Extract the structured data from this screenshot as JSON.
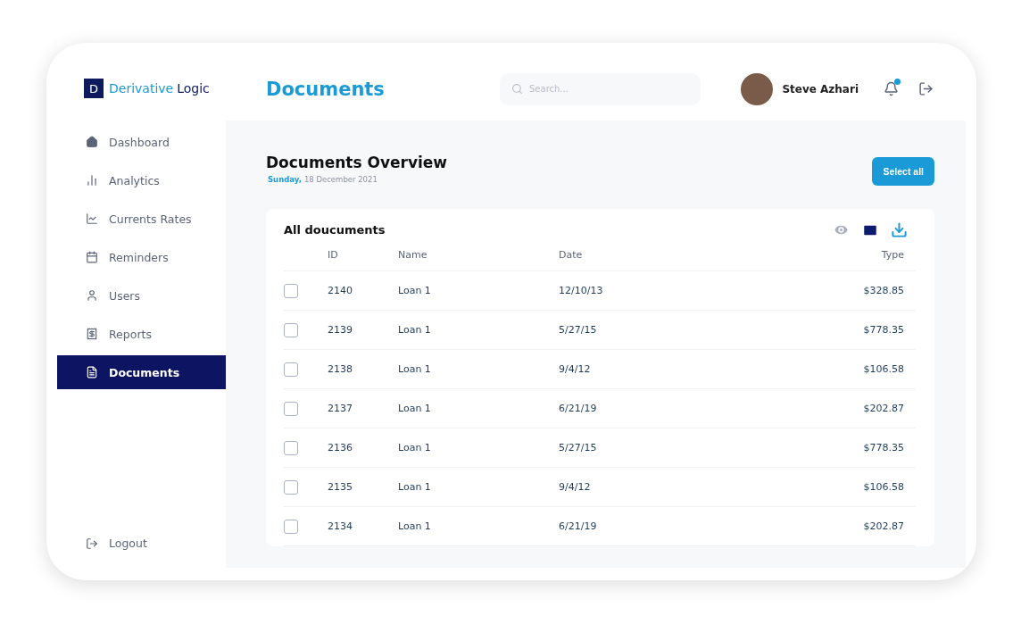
{
  "brand": {
    "mark": "D",
    "word_1": "Derivative",
    "word_2": "Logic"
  },
  "sidebar": {
    "items": [
      {
        "label": "Dashboard",
        "selected": false
      },
      {
        "label": "Analytics",
        "selected": false
      },
      {
        "label": "Currents Rates",
        "selected": false
      },
      {
        "label": "Reminders",
        "selected": false
      },
      {
        "label": "Users",
        "selected": false
      },
      {
        "label": "Reports",
        "selected": false
      },
      {
        "label": "Documents",
        "selected": true
      }
    ],
    "logout": "Logout"
  },
  "header": {
    "title": "Documents",
    "search": {
      "placeholder": "Search..."
    },
    "user": {
      "name": "Steve Azhari"
    },
    "notifications": {
      "unread": true
    }
  },
  "overview": {
    "title": "Documents Overview",
    "day": "Sunday,",
    "date": "18 December 2021",
    "select_all": "Select all"
  },
  "table": {
    "title": "All doucuments",
    "columns": [
      "ID",
      "Name",
      "Date",
      "Type"
    ],
    "rows": [
      {
        "id": "2140",
        "name": "Loan 1",
        "date": "12/10/13",
        "type": "$328.85",
        "checked": false
      },
      {
        "id": "2139",
        "name": "Loan 1",
        "date": "5/27/15",
        "type": "$778.35",
        "checked": false
      },
      {
        "id": "2138",
        "name": "Loan 1",
        "date": "9/4/12",
        "type": "$106.58",
        "checked": false
      },
      {
        "id": "2137",
        "name": "Loan 1",
        "date": "6/21/19",
        "type": "$202.87",
        "checked": false
      },
      {
        "id": "2136",
        "name": "Loan 1",
        "date": "5/27/15",
        "type": "$778.35",
        "checked": false
      },
      {
        "id": "2135",
        "name": "Loan 1",
        "date": "9/4/12",
        "type": "$106.58",
        "checked": false
      },
      {
        "id": "2134",
        "name": "Loan 1",
        "date": "6/21/19",
        "type": "$202.87",
        "checked": false
      }
    ]
  }
}
